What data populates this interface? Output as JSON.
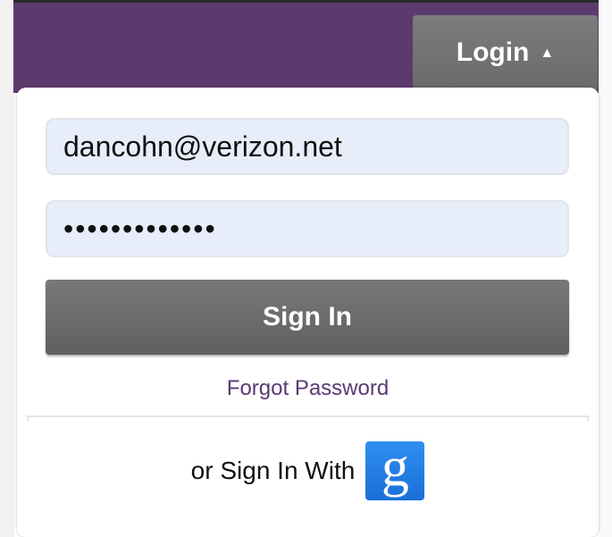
{
  "header": {
    "login_label": "Login",
    "login_caret": "▲"
  },
  "form": {
    "email_value": "dancohn@verizon.net",
    "password_value": "•••••••••••••",
    "signin_label": "Sign In",
    "forgot_label": "Forgot Password",
    "social_label": "or Sign In With",
    "google_glyph": "g"
  },
  "colors": {
    "header_purple": "#5c3a6e",
    "button_gray": "#6a6b6b",
    "link_purple": "#5a3a73",
    "input_bg": "#e8edfa",
    "google_blue": "#1a6fd8"
  },
  "icons": {
    "caret": "caret-up-icon",
    "google": "google-icon"
  }
}
